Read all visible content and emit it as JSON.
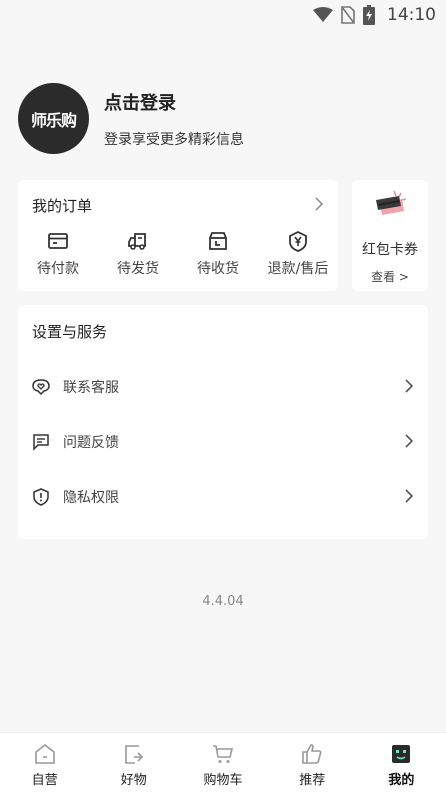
{
  "status_bar": {
    "time": "14:10"
  },
  "profile": {
    "avatar_text": "师乐购",
    "login_title": "点击登录",
    "login_subtitle": "登录享受更多精彩信息"
  },
  "orders": {
    "title": "我的订单",
    "items": [
      {
        "label": "待付款",
        "icon": "card-icon"
      },
      {
        "label": "待发货",
        "icon": "truck-icon"
      },
      {
        "label": "待收货",
        "icon": "box-icon"
      },
      {
        "label": "退款/售后",
        "icon": "yen-shield-icon"
      }
    ]
  },
  "coupon": {
    "title": "红包卡券",
    "link": "查看 >"
  },
  "settings": {
    "title": "设置与服务",
    "items": [
      {
        "label": "联系客服",
        "icon": "heart-chat-icon"
      },
      {
        "label": "问题反馈",
        "icon": "message-icon"
      },
      {
        "label": "隐私权限",
        "icon": "shield-alert-icon"
      }
    ]
  },
  "version": "4.4.04",
  "bottom_nav": {
    "items": [
      {
        "label": "自营",
        "icon": "home-icon"
      },
      {
        "label": "好物",
        "icon": "share-icon"
      },
      {
        "label": "购物车",
        "icon": "cart-icon"
      },
      {
        "label": "推荐",
        "icon": "thumbs-up-icon"
      },
      {
        "label": "我的",
        "icon": "profile-face-icon"
      }
    ],
    "active_index": 4
  },
  "colors": {
    "background": "#f7f7f7",
    "card": "#ffffff",
    "avatar": "#2b2b2b"
  }
}
